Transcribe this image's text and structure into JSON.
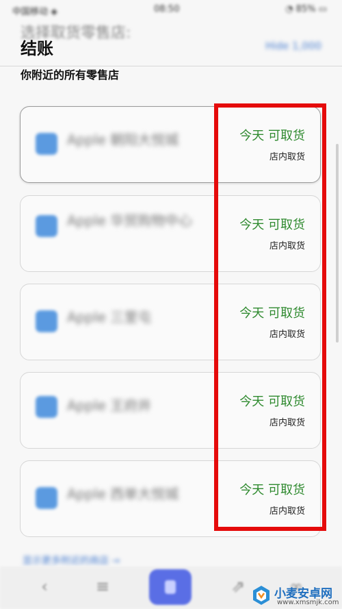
{
  "status_bar": {
    "carrier": "中国移动 ◈",
    "time": "08:50",
    "battery": "◔ 85% ▭"
  },
  "header": {
    "ghost_title": "选择取货零售店:",
    "title": "结账",
    "link_label": "Hide 1,000"
  },
  "subtitle": "你附近的所有零售店",
  "stores": [
    {
      "name": "Apple 朝阳大悦城",
      "availability": "今天 可取货",
      "method": "店内取货"
    },
    {
      "name": "Apple 华贸购物中心",
      "availability": "今天 可取货",
      "method": "店内取货"
    },
    {
      "name": "Apple 三里屯",
      "availability": "今天 可取货",
      "method": "店内取货"
    },
    {
      "name": "Apple 王府井",
      "availability": "今天 可取货",
      "method": "店内取货"
    },
    {
      "name": "Apple 西单大悦城",
      "availability": "今天 可取货",
      "method": "店内取货"
    }
  ],
  "more_link": "显示更多附近的商店 →",
  "bottom_nav": {
    "icons": [
      "back-icon",
      "bag-icon",
      "cart-icon",
      "share-icon",
      "more-icon"
    ]
  },
  "watermark": {
    "name": "小麦安卓网",
    "url": "www.xmsmjk.com"
  },
  "colors": {
    "available": "#2f8a2f",
    "highlight": "#e50b0b",
    "accent": "#5a6ee5",
    "store_icon": "#5b9ae0"
  }
}
